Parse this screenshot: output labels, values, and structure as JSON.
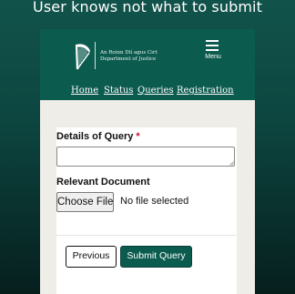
{
  "caption": "User knows not what to submit",
  "header": {
    "department_irish": "An Roinn Dlí agus Cirt",
    "department_english": "Department of Justice",
    "menu_label": "Menu",
    "logo_icon": "harp-icon",
    "menu_icon": "hamburger-icon"
  },
  "nav": {
    "items": [
      {
        "label": "Home"
      },
      {
        "label": "Status"
      },
      {
        "label": "Queries"
      },
      {
        "label": "Registration"
      }
    ]
  },
  "form": {
    "details_label": "Details of Query",
    "required_marker": "*",
    "details_value": "",
    "document_label": "Relevant Document",
    "choose_file_label": "Choose File",
    "no_file_text": "No file selected"
  },
  "actions": {
    "previous_label": "Previous",
    "submit_label": "Submit Query"
  },
  "colors": {
    "brand_green": "#0c5b4f",
    "page_background": "#eeede7",
    "required_red": "#c8102e"
  }
}
